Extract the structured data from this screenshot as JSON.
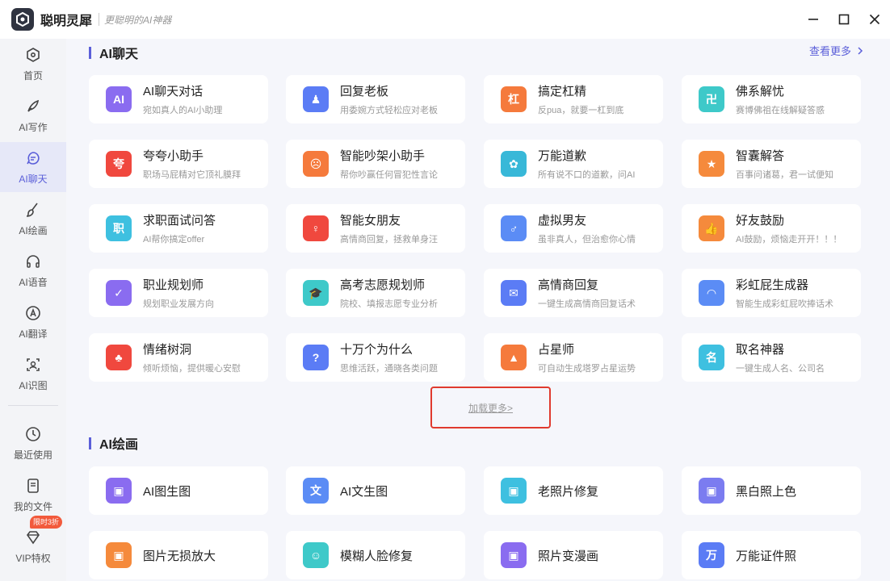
{
  "app": {
    "title": "聪明灵犀",
    "slogan": "更聪明的AI神器"
  },
  "sidebar": {
    "items": [
      {
        "label": "首页",
        "icon": "home-icon"
      },
      {
        "label": "AI写作",
        "icon": "pen-icon"
      },
      {
        "label": "AI聊天",
        "icon": "chat-icon",
        "active": true
      },
      {
        "label": "AI绘画",
        "icon": "brush-icon"
      },
      {
        "label": "AI语音",
        "icon": "headphones-icon"
      },
      {
        "label": "AI翻译",
        "icon": "translate-icon"
      },
      {
        "label": "AI识图",
        "icon": "scan-icon"
      },
      {
        "label": "最近使用",
        "icon": "clock-icon"
      },
      {
        "label": "我的文件",
        "icon": "file-icon"
      },
      {
        "label": "VIP特权",
        "icon": "diamond-icon"
      }
    ],
    "vip_badge": "限时3折"
  },
  "chat_section": {
    "title": "AI聊天",
    "see_more": "查看更多",
    "cards": [
      {
        "title": "AI聊天对话",
        "desc": "宛如真人的AI小助理",
        "color": "#8a6cf0",
        "glyph": "AI"
      },
      {
        "title": "回复老板",
        "desc": "用委婉方式轻松应对老板",
        "color": "#5b7cf5",
        "glyph": "♟"
      },
      {
        "title": "搞定杠精",
        "desc": "反pua，就要一杠到底",
        "color": "#f57a3c",
        "glyph": "杠"
      },
      {
        "title": "佛系解忧",
        "desc": "赛博佛祖在线解疑答惑",
        "color": "#3ec9c9",
        "glyph": "卍"
      },
      {
        "title": "夸夸小助手",
        "desc": "职场马屁精对它顶礼膜拜",
        "color": "#f0483e",
        "glyph": "夸"
      },
      {
        "title": "智能吵架小助手",
        "desc": "帮你吵赢任何冒犯性言论",
        "color": "#f57a3c",
        "glyph": "☹"
      },
      {
        "title": "万能道歉",
        "desc": "所有说不口的道歉，问AI",
        "color": "#38b8d8",
        "glyph": "✿"
      },
      {
        "title": "智囊解答",
        "desc": "百事问诸葛，君一试便知",
        "color": "#f58a3c",
        "glyph": "★"
      },
      {
        "title": "求职面试问答",
        "desc": "AI帮你搞定offer",
        "color": "#3ec0e0",
        "glyph": "职"
      },
      {
        "title": "智能女朋友",
        "desc": "高情商回复，拯救单身汪",
        "color": "#f0483e",
        "glyph": "♀"
      },
      {
        "title": "虚拟男友",
        "desc": "虽非真人，但治愈你心情",
        "color": "#5b8cf5",
        "glyph": "♂"
      },
      {
        "title": "好友鼓励",
        "desc": "AI鼓励，烦恼走开开！！！",
        "color": "#f58a3c",
        "glyph": "👍"
      },
      {
        "title": "职业规划师",
        "desc": "规划职业发展方向",
        "color": "#8a6cf0",
        "glyph": "✓"
      },
      {
        "title": "高考志愿规划师",
        "desc": "院校、填报志愿专业分析",
        "color": "#3ec9c9",
        "glyph": "🎓"
      },
      {
        "title": "高情商回复",
        "desc": "一键生成高情商回复话术",
        "color": "#5b7cf5",
        "glyph": "✉"
      },
      {
        "title": "彩虹屁生成器",
        "desc": "智能生成彩虹屁吹捧话术",
        "color": "#5b8cf5",
        "glyph": "◠"
      },
      {
        "title": "情绪树洞",
        "desc": "倾听烦恼，提供暖心安慰",
        "color": "#f0483e",
        "glyph": "♣"
      },
      {
        "title": "十万个为什么",
        "desc": "思维活跃，通晓各类问题",
        "color": "#5b7cf5",
        "glyph": "?"
      },
      {
        "title": "占星师",
        "desc": "可自动生成塔罗占星运势",
        "color": "#f57a3c",
        "glyph": "▲"
      },
      {
        "title": "取名神器",
        "desc": "一键生成人名、公司名",
        "color": "#3ec0e0",
        "glyph": "名"
      }
    ],
    "load_more": "加载更多>"
  },
  "paint_section": {
    "title": "AI绘画",
    "cards": [
      {
        "title": "AI图生图",
        "color": "#8a6cf0",
        "glyph": "▣"
      },
      {
        "title": "AI文生图",
        "color": "#5b8cf5",
        "glyph": "文"
      },
      {
        "title": "老照片修复",
        "color": "#3ec0e0",
        "glyph": "▣"
      },
      {
        "title": "黑白照上色",
        "color": "#7b7cf0",
        "glyph": "▣"
      },
      {
        "title": "图片无损放大",
        "color": "#f58a3c",
        "glyph": "▣"
      },
      {
        "title": "模糊人脸修复",
        "color": "#3ec9c9",
        "glyph": "☺"
      },
      {
        "title": "照片变漫画",
        "color": "#8a6cf0",
        "glyph": "▣"
      },
      {
        "title": "万能证件照",
        "color": "#5b7cf5",
        "glyph": "万"
      }
    ]
  }
}
